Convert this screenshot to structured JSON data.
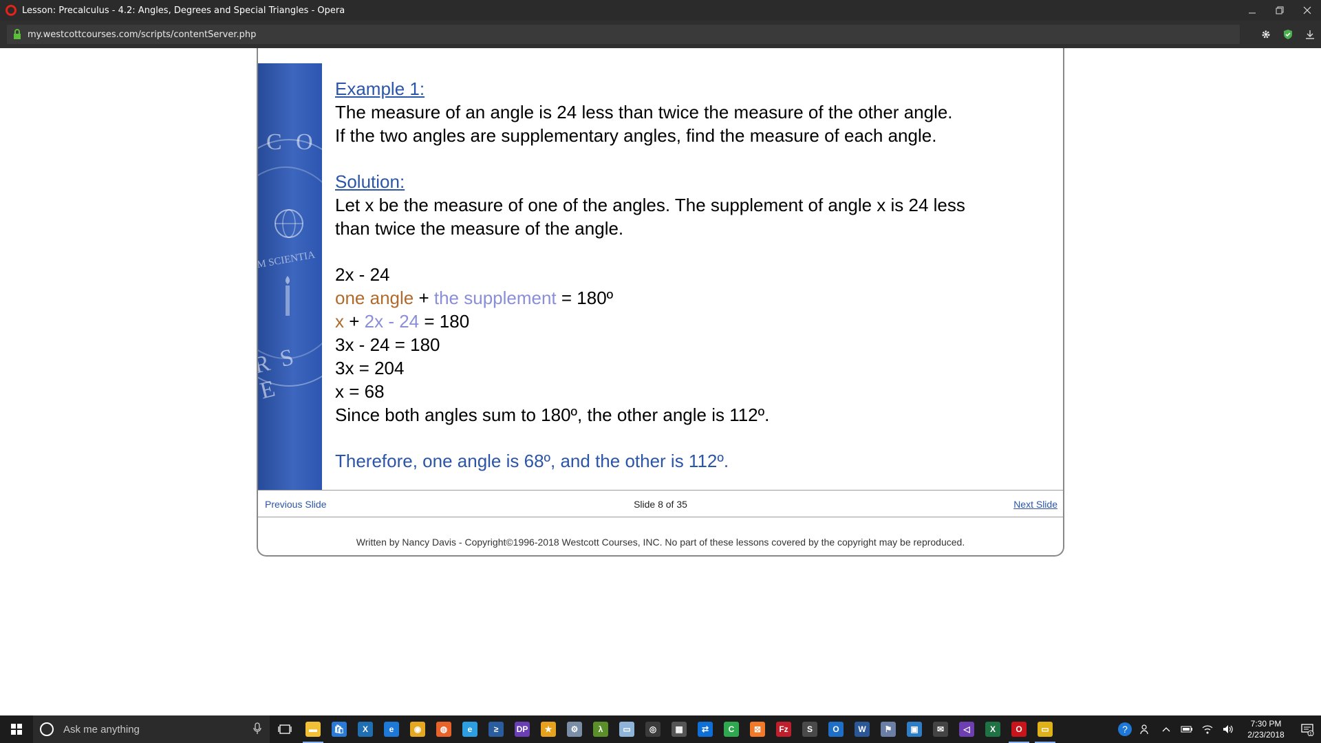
{
  "browser": {
    "window_title": "Lesson: Precalculus - 4.2: Angles, Degrees and Special Triangles - Opera",
    "url": "my.westcottcourses.com/scripts/contentServer.php"
  },
  "slide": {
    "example_heading": "Example 1:",
    "problem_line1": "The measure of an angle is 24 less than twice the measure of the other angle.",
    "problem_line2": "If the two angles are supplementary angles, find the measure of each angle.",
    "solution_heading": "Solution:",
    "solution_line1": "Let x be the measure of one of the angles.  The supplement of angle x is 24 less",
    "solution_line2": "than twice the measure of the angle.",
    "eq1": "2x - 24",
    "eq2_part1": "one angle",
    "eq2_part2": " + ",
    "eq2_part3": "the supplement",
    "eq2_part4": " = 180º",
    "eq3_part1": "x",
    "eq3_part2": " + ",
    "eq3_part3": "2x - 24",
    "eq3_part4": " = 180",
    "eq4": "3x - 24 = 180",
    "eq5": "3x = 204",
    "eq6": "x = 68",
    "eq7": "Since both angles sum to 180º, the other angle is 112º.",
    "conclusion": "Therefore, one angle is 68º, and the other is 112º.",
    "seal_text_top": "C O",
    "seal_text_mid": "M SCIENTIA",
    "seal_text_bottom": "R S E"
  },
  "nav": {
    "previous": "Previous Slide",
    "counter": "Slide 8 of 35",
    "next": "Next Slide"
  },
  "footer": {
    "copyright": "Written by Nancy Davis - Copyright©1996-2018 Westcott Courses, INC. No part of these lessons covered by the copyright may be reproduced."
  },
  "taskbar": {
    "search_placeholder": "Ask me anything",
    "time": "7:30 PM",
    "date": "2/23/2018",
    "notification_count": "1",
    "apps": [
      {
        "name": "file-explorer",
        "color": "#f2c037",
        "glyph": "▬"
      },
      {
        "name": "store",
        "color": "#2a7ad6",
        "glyph": "🛍"
      },
      {
        "name": "app-x",
        "color": "#1f6fb2",
        "glyph": "X"
      },
      {
        "name": "edge",
        "color": "#1e78d7",
        "glyph": "e"
      },
      {
        "name": "chrome",
        "color": "#e5a823",
        "glyph": "◉"
      },
      {
        "name": "firefox",
        "color": "#e8632a",
        "glyph": "◍"
      },
      {
        "name": "internet-explorer",
        "color": "#2d9ee0",
        "glyph": "e"
      },
      {
        "name": "powershell",
        "color": "#2a5d9e",
        "glyph": "≥"
      },
      {
        "name": "dp-app",
        "color": "#6a3fb4",
        "glyph": "DP"
      },
      {
        "name": "star-app",
        "color": "#e6a21e",
        "glyph": "★"
      },
      {
        "name": "tool-app",
        "color": "#7a8ea8",
        "glyph": "⚙"
      },
      {
        "name": "lambda-app",
        "color": "#5a8f2a",
        "glyph": "λ"
      },
      {
        "name": "notes-app",
        "color": "#8fb4d9",
        "glyph": "▭"
      },
      {
        "name": "bandicam",
        "color": "#3b3b3b",
        "glyph": "◎"
      },
      {
        "name": "calculator",
        "color": "#555555",
        "glyph": "▦"
      },
      {
        "name": "teamviewer",
        "color": "#0e6fd6",
        "glyph": "⇄"
      },
      {
        "name": "camtasia",
        "color": "#2fa84f",
        "glyph": "C"
      },
      {
        "name": "xampp",
        "color": "#f07a2a",
        "glyph": "⊠"
      },
      {
        "name": "filezilla",
        "color": "#bf1e2d",
        "glyph": "Fz"
      },
      {
        "name": "sublime",
        "color": "#4a4a4a",
        "glyph": "S"
      },
      {
        "name": "outlook",
        "color": "#1f6fc7",
        "glyph": "O"
      },
      {
        "name": "word",
        "color": "#2b5797",
        "glyph": "W"
      },
      {
        "name": "network-app",
        "color": "#6b7fa6",
        "glyph": "⚑"
      },
      {
        "name": "remote-desktop",
        "color": "#2f7dc5",
        "glyph": "▣"
      },
      {
        "name": "mail",
        "color": "#444444",
        "glyph": "✉"
      },
      {
        "name": "visual-studio",
        "color": "#6d3fb0",
        "glyph": "◁"
      },
      {
        "name": "excel",
        "color": "#1f7244",
        "glyph": "X"
      },
      {
        "name": "opera",
        "color": "#c8141b",
        "glyph": "O"
      },
      {
        "name": "yellow-app",
        "color": "#e0b21a",
        "glyph": "▭"
      }
    ]
  }
}
